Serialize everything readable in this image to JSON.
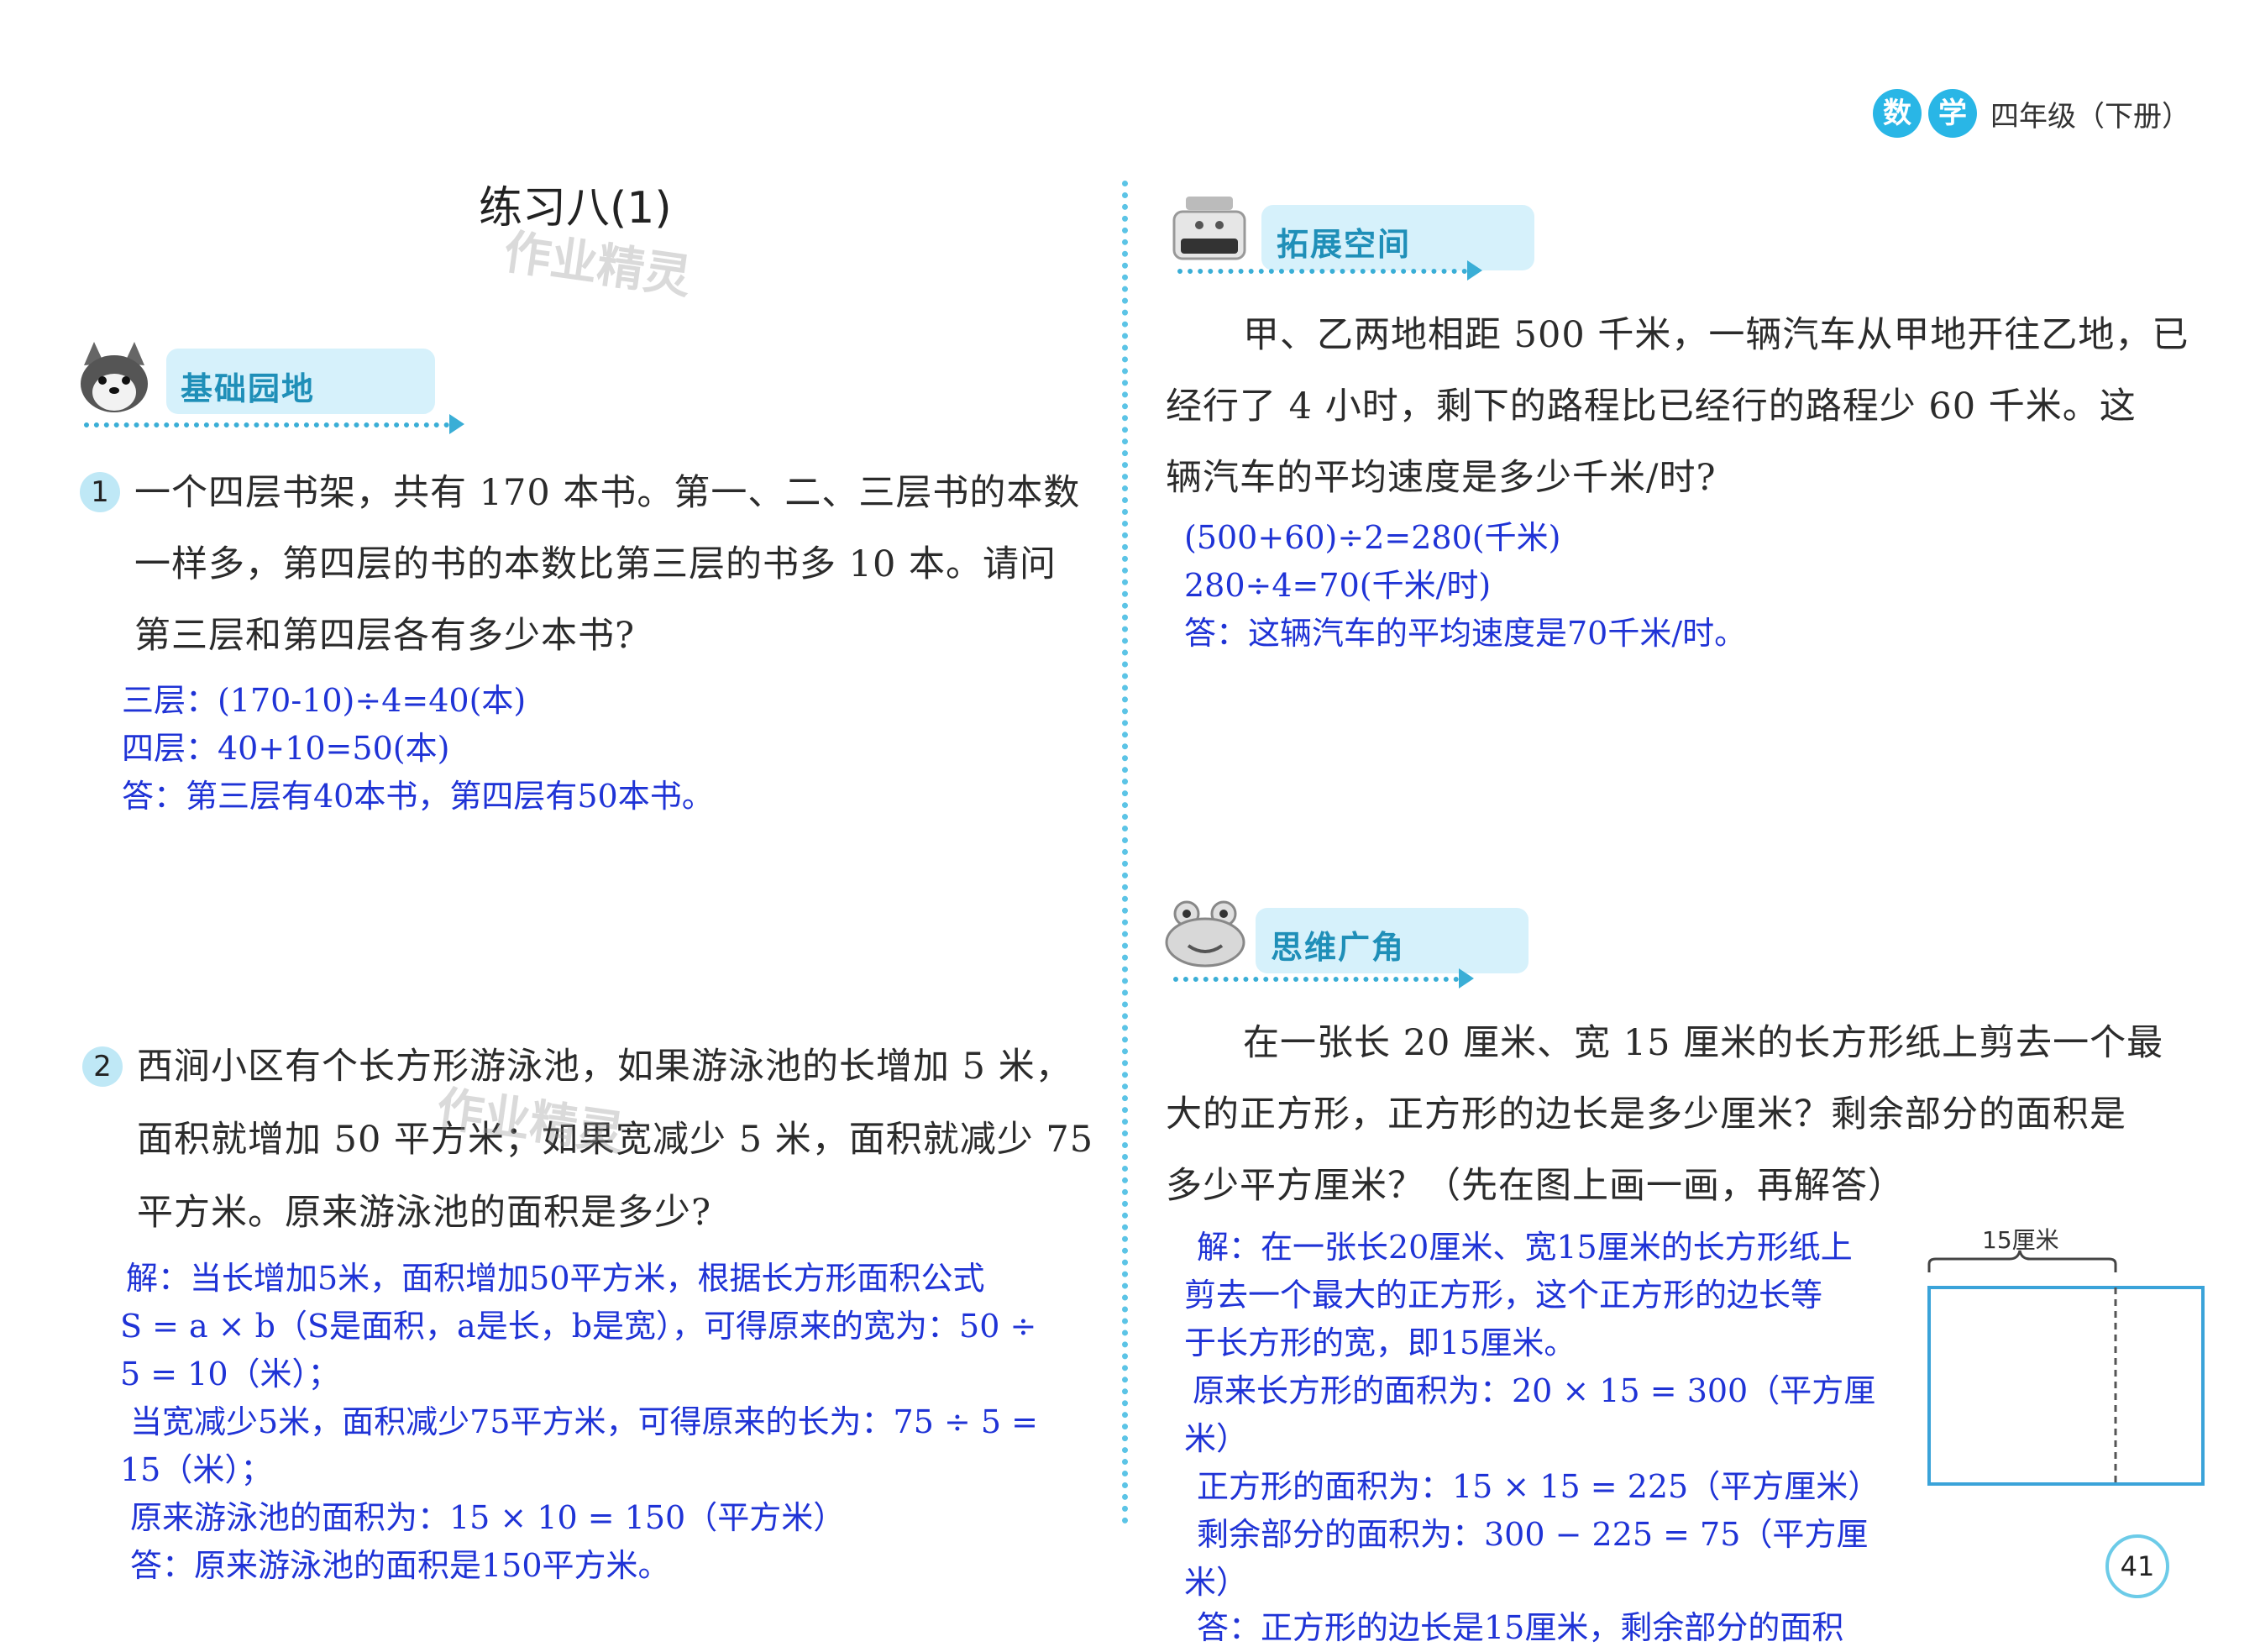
{
  "header": {
    "subject_chars": [
      "数",
      "学"
    ],
    "grade": "四年级（下册）"
  },
  "page_number": "41",
  "left": {
    "title": "练习八(1)",
    "watermark": "作业精灵",
    "section": "基础园地",
    "q1": {
      "num": "1",
      "lines": [
        "一个四层书架，共有 170 本书。第一、二、三层书的本数",
        "一样多，第四层的书的本数比第三层的书多 10 本。请问",
        "第三层和第四层各有多少本书?"
      ],
      "answer": [
        "三层：(170-10)÷4=40(本)",
        "四层：40+10=50(本)",
        "答：第三层有40本书，第四层有50本书。"
      ]
    },
    "q2": {
      "num": "2",
      "lines": [
        "西涧小区有个长方形游泳池，如果游泳池的长增加 5 米，",
        "面积就增加 50 平方米；如果宽减少 5 米，面积就减少 75",
        "平方米。原来游泳池的面积是多少?"
      ],
      "answer": [
        "解：当长增加5米，面积增加50平方米，根据长方形面积公式",
        "S = a × b（S是面积，a是长，b是宽），可得原来的宽为：50 ÷",
        "5 = 10（米）；",
        "当宽减少5米，面积减少75平方米，可得原来的长为：75 ÷ 5 =",
        "15（米）；",
        "原来游泳池的面积为：15 × 10 = 150（平方米）",
        "答：原来游泳池的面积是150平方米。"
      ]
    }
  },
  "right": {
    "section1": "拓展空间",
    "q3": {
      "lines": [
        "甲、乙两地相距 500 千米，一辆汽车从甲地开往乙地，已",
        "经行了 4 小时，剩下的路程比已经行的路程少 60 千米。这",
        "辆汽车的平均速度是多少千米/时?"
      ],
      "answer": [
        "(500+60)÷2=280(千米)",
        "280÷4=70(千米/时)",
        "答：这辆汽车的平均速度是70千米/时。"
      ]
    },
    "section2": "思维广角",
    "q4": {
      "lines": [
        "在一张长 20 厘米、宽 15 厘米的长方形纸上剪去一个最",
        "大的正方形，正方形的边长是多少厘米？剩余部分的面积是",
        "多少平方厘米？（先在图上画一画，再解答）"
      ],
      "answer": [
        "解：在一张长20厘米、宽15厘米的长方形纸上",
        "剪去一个最大的正方形，这个正方形的边长等",
        "于长方形的宽，即15厘米。",
        "原来长方形的面积为：20 × 15 = 300（平方厘",
        "米）",
        "正方形的面积为：15 × 15 = 225（平方厘米）",
        "剩余部分的面积为：300 − 225 = 75（平方厘",
        "米）",
        "答：正方形的边长是15厘米，剩余部分的面积"
      ],
      "figure_label": "15厘米"
    }
  }
}
